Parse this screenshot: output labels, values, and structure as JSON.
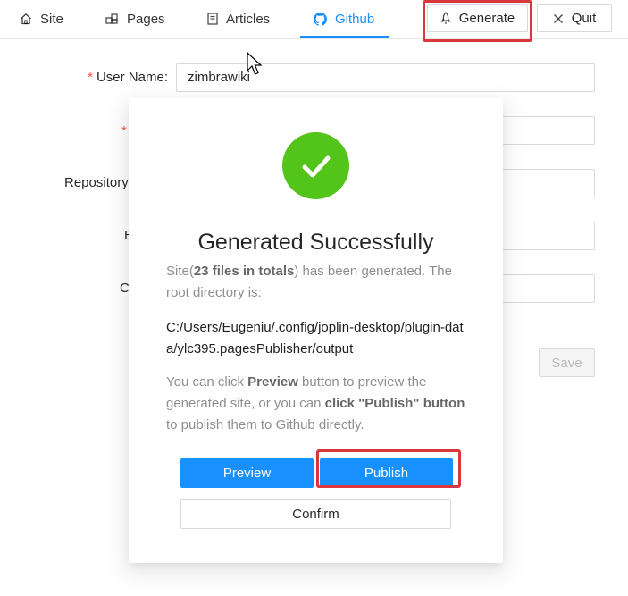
{
  "nav": {
    "tabs": [
      {
        "label": "Site",
        "icon": "home-icon"
      },
      {
        "label": "Pages",
        "icon": "pages-icon"
      },
      {
        "label": "Articles",
        "icon": "articles-icon"
      },
      {
        "label": "Github",
        "icon": "github-icon",
        "active": true
      }
    ],
    "generate_label": "Generate",
    "quit_label": "Quit"
  },
  "form": {
    "user_name_label": "User Name:",
    "user_name_value": "zimbrawiki",
    "repository_label_fragment": "Repository",
    "branch_label_fragment": "B",
    "cname_label_fragment": "Cl",
    "save_label": "Save"
  },
  "modal": {
    "title": "Generated Successfully",
    "intro_prefix": "Site(",
    "intro_bold": "23 files in totals",
    "intro_suffix": ") has been generated. The root directory is:",
    "path": "C:/Users/Eugeniu/.config/joplin-desktop/plugin-data/ylc395.pagesPublisher/output",
    "hint_1": "You can click ",
    "hint_preview_bold": "Preview",
    "hint_2": " button to preview the generated site, or you can ",
    "hint_publish_bold": "click \"Publish\" button",
    "hint_3": " to publish them to Github directly.",
    "preview_label": "Preview",
    "publish_label": "Publish",
    "confirm_label": "Confirm"
  },
  "colors": {
    "accent": "#1890ff",
    "success": "#52c41a",
    "highlight_box": "#d9363e"
  }
}
